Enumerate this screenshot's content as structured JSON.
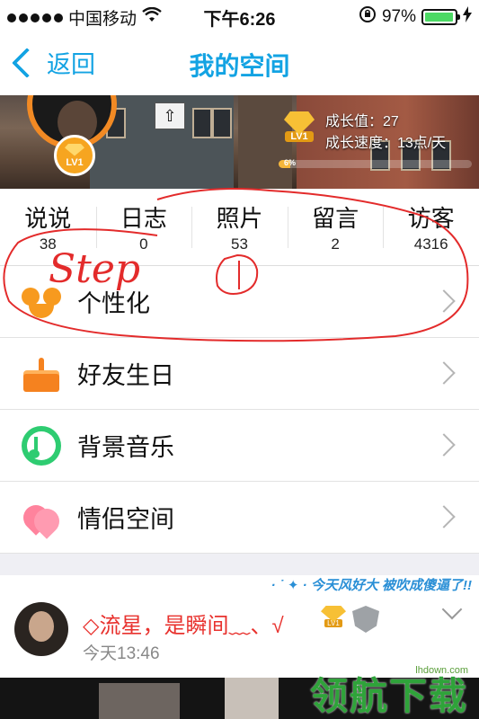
{
  "status_bar": {
    "carrier": "中国移动",
    "time": "下午6:26",
    "battery_percent": "97%",
    "battery_level": 0.97
  },
  "nav": {
    "back_label": "返回",
    "title": "我的空间"
  },
  "banner": {
    "level_tag": "LV1",
    "growth_value": "成长值：27",
    "growth_speed": "成长速度：13点/天",
    "progress_label": "6%",
    "progress_fraction": 0.06
  },
  "stats": [
    {
      "label": "说说",
      "count": "38"
    },
    {
      "label": "日志",
      "count": "0"
    },
    {
      "label": "照片",
      "count": "53"
    },
    {
      "label": "留言",
      "count": "2"
    },
    {
      "label": "访客",
      "count": "4316"
    }
  ],
  "menu": [
    {
      "label": "个性化",
      "icon": "mask-icon"
    },
    {
      "label": "好友生日",
      "icon": "cake-icon"
    },
    {
      "label": "背景音乐",
      "icon": "music-icon"
    },
    {
      "label": "情侣空间",
      "icon": "heart-icon"
    }
  ],
  "feed": {
    "decoration_text": "· ˙ ✦ · 今天风好大 被吹成傻逼了!!",
    "post_title": "◇流星，是瞬间﹏、√",
    "badge_level": "LV1",
    "post_time": "今天13:46"
  },
  "annotation": {
    "text_step": "Step",
    "text_num": "①",
    "color": "#e32b2b"
  },
  "watermark": {
    "small": "lhdown.com",
    "big": "领航下载"
  },
  "colors": {
    "accent": "#13a3e3",
    "battery": "#4cd964",
    "post_title": "#e8322e"
  }
}
